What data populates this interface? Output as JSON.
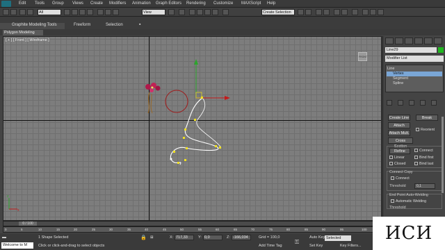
{
  "menu": {
    "items": [
      "Edit",
      "Tools",
      "Group",
      "Views",
      "Create",
      "Modifiers",
      "Animation",
      "Graph Editors",
      "Rendering",
      "Customize",
      "MAXScript",
      "Help"
    ]
  },
  "toolbar": {
    "filter_select": "All",
    "ref_coord_select": "View",
    "selection_set": "Create Selection S"
  },
  "ribbon": {
    "tabs": [
      "Graphite Modeling Tools",
      "Freeform",
      "Selection"
    ],
    "panel_label": "Polygon Modeling"
  },
  "viewport": {
    "label": "[ + ] [ Front ] [ Wireframe ]"
  },
  "command_panel": {
    "object_name": "Line29",
    "object_color": "#1fb81f",
    "modifier_list": "Modifier List",
    "stack": [
      "Line",
      "Vertex",
      "Segment",
      "Spline"
    ],
    "selected_stack_item": "Vertex",
    "buttons": {
      "create_line": "Create Line",
      "break": "Break",
      "attach": "Attach",
      "reorient": "Reorient",
      "attach_mult": "Attach Mult.",
      "cross_section": "Cross Section",
      "refine": "Refine",
      "connect": "Connect"
    },
    "checks": {
      "linear": "Linear",
      "bind_first": "Bind first",
      "closed": "Closed",
      "bind_last": "Bind last",
      "connect_copy_title": "Connect Copy",
      "connect": "Connect",
      "threshold": "Threshold",
      "threshold_value": "0,1",
      "end_point_title": "End Point Auto-Welding",
      "automatic_welding": "Automatic Welding",
      "threshold2": "Threshold"
    }
  },
  "timeline": {
    "frame_display": "0 / 100",
    "ticks": [
      "0",
      "5",
      "10",
      "15",
      "20",
      "25",
      "30",
      "35",
      "40",
      "45",
      "50",
      "55",
      "60",
      "65",
      "70",
      "75",
      "80",
      "85",
      "90",
      "95",
      "100"
    ]
  },
  "status": {
    "listener": "Welcome to M",
    "selection_text": "1 Shape Selected",
    "prompt_text": "Click or click-and-drag to select objects",
    "x_label": "X:",
    "x_value": "717,33",
    "y_label": "Y:",
    "y_value": "0,0",
    "z_label": "Z:",
    "z_value": "-166,034",
    "grid": "Grid = 100,0",
    "add_time_tag": "Add Time Tag",
    "auto_key": "Auto Key",
    "key_mode": "Selected",
    "set_key": "Set Key",
    "key_filters": "Key Filters..."
  },
  "watermark": "ИСИ"
}
